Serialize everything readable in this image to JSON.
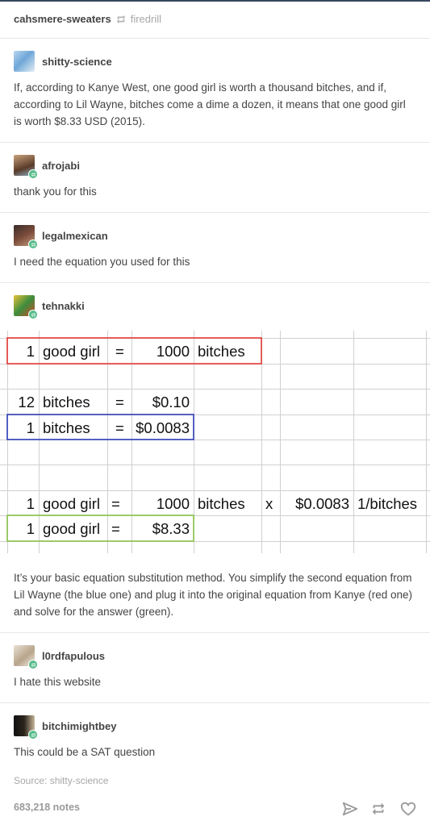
{
  "header": {
    "reblogger": "cahsmere-sweaters",
    "source": "firedrill"
  },
  "posts": [
    {
      "user": "shitty-science",
      "text": "If, according to Kanye West, one good girl is worth a thousand bitches, and if, according to Lil Wayne, bitches come a dime a dozen, it means that one good girl is worth $8.33 USD (2015)."
    },
    {
      "user": "afrojabi",
      "text": "thank you for this"
    },
    {
      "user": "legalmexican",
      "text": "I need the equation you used for this"
    },
    {
      "user": "tehnakki",
      "text": "It’s your basic equation substitution method. You simplify the second equation from Lil Wayne (the blue one) and plug it into the original equation from Kanye (red one) and solve for the answer (green)."
    },
    {
      "user": "l0rdfapulous",
      "text": "I hate this website"
    },
    {
      "user": "bitchimightbey",
      "text": "This could be a SAT question"
    }
  ],
  "sheet": {
    "row1": [
      "1",
      "good girl",
      "=",
      "1000",
      "bitches"
    ],
    "row3": [
      "12",
      "bitches",
      "=",
      "$0.10"
    ],
    "row4": [
      "1",
      "bitches",
      "=",
      "$0.0083"
    ],
    "row7": [
      "1",
      "good girl",
      "=",
      "1000",
      "bitches",
      "x",
      "$0.0083",
      "1/bitches"
    ],
    "row8": [
      "1",
      "good girl",
      "=",
      "$8.33"
    ]
  },
  "footer": {
    "source": "Source: shitty-science",
    "notes": "683,218 notes"
  },
  "colors": {
    "red": "#e53935",
    "blue": "#2e3fb8",
    "green": "#8bc34a",
    "badge": "#56bc8a"
  }
}
